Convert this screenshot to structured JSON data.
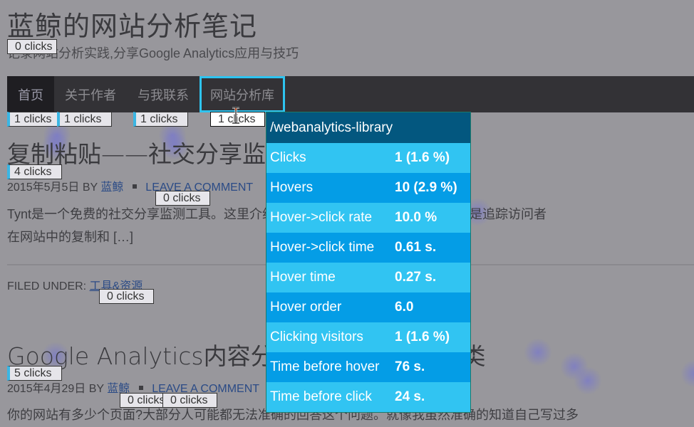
{
  "site": {
    "title": "蓝鲸的网站分析笔记",
    "description": "记录网站分析实践,分享Google Analytics应用与技巧"
  },
  "nav": {
    "items": [
      {
        "label": "首页",
        "clicks": "1 clicks"
      },
      {
        "label": "关于作者",
        "clicks": "1 clicks"
      },
      {
        "label": "与我联系",
        "clicks": "1 clicks"
      },
      {
        "label": "网站分析库",
        "clicks": "1 clicks"
      }
    ]
  },
  "badges": {
    "site_title": "0 clicks",
    "article1_title": "4 clicks",
    "article1_comment": "0 clicks",
    "article1_category": "0 clicks",
    "article2_title": "5 clicks",
    "article2_author": "0 clicks",
    "article2_comment": "0 clicks"
  },
  "articles": [
    {
      "title": "复制粘贴——社交分享监测工具",
      "date": "2015年5月5日",
      "by": "BY",
      "author": "蓝鲸",
      "comment_link": "LEAVE A COMMENT",
      "excerpt_line1": "Tynt是一个免费的社交分享监测工具。这里介绍一下Tynt这个工具,他的主要功能就是追踪访问者",
      "excerpt_line2": "在网站中的复制和 […]",
      "filed_label": "FILED UNDER:",
      "category": "工具&资源"
    },
    {
      "title": "Google Analytics内容分组——内容页面分类",
      "date": "2015年4月29日",
      "by": "BY",
      "author": "蓝鲸",
      "comment_link": "LEAVE A COMMENT",
      "excerpt_line1": "你的网站有多少个页面?大部分人可能都无法准确的回答这个问题。就像我虽然准确的知道自己写过多"
    }
  ],
  "popup": {
    "title": "/webanalytics-library",
    "rows": [
      {
        "label": "Clicks",
        "value": "1 (1.6 %)"
      },
      {
        "label": "Hovers",
        "value": "10 (2.9 %)"
      },
      {
        "label": "Hover->click rate",
        "value": "10.0 %"
      },
      {
        "label": "Hover->click time",
        "value": "0.61 s."
      },
      {
        "label": "Hover time",
        "value": "0.27 s."
      },
      {
        "label": "Hover order",
        "value": "6.0"
      },
      {
        "label": "Clicking visitors",
        "value": "1 (1.6 %)"
      },
      {
        "label": "Time before hover",
        "value": "76 s."
      },
      {
        "label": "Time before click",
        "value": "24 s."
      }
    ]
  },
  "colors": {
    "overlay_bg": "#98979c",
    "nav_bg": "#333236",
    "popup_header": "#03577f",
    "popup_row_light": "#31c4f2",
    "popup_row_dark": "#049de6",
    "highlight_outline": "#2ec4f0",
    "link": "#2b4b86"
  }
}
